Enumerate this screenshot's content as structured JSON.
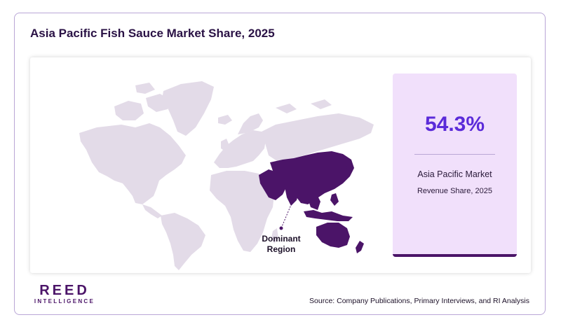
{
  "title": "Asia Pacific Fish Sauce Market Share, 2025",
  "stat": {
    "value": "54.3%",
    "label": "Asia Pacific Market",
    "sublabel": "Revenue Share, 2025"
  },
  "map": {
    "callout_line1": "Dominant",
    "callout_line2": "Region",
    "highlight_color": "#4b1468",
    "base_color": "#e3dbe8"
  },
  "logo": {
    "main": "REED",
    "sub": "INTELLIGENCE"
  },
  "source": "Source: Company Publications, Primary Interviews, and RI Analysis",
  "colors": {
    "accent": "#5b2bd9",
    "brand": "#4b1468",
    "card_bg": "#f1e0fb",
    "border": "#b9a6d6"
  }
}
